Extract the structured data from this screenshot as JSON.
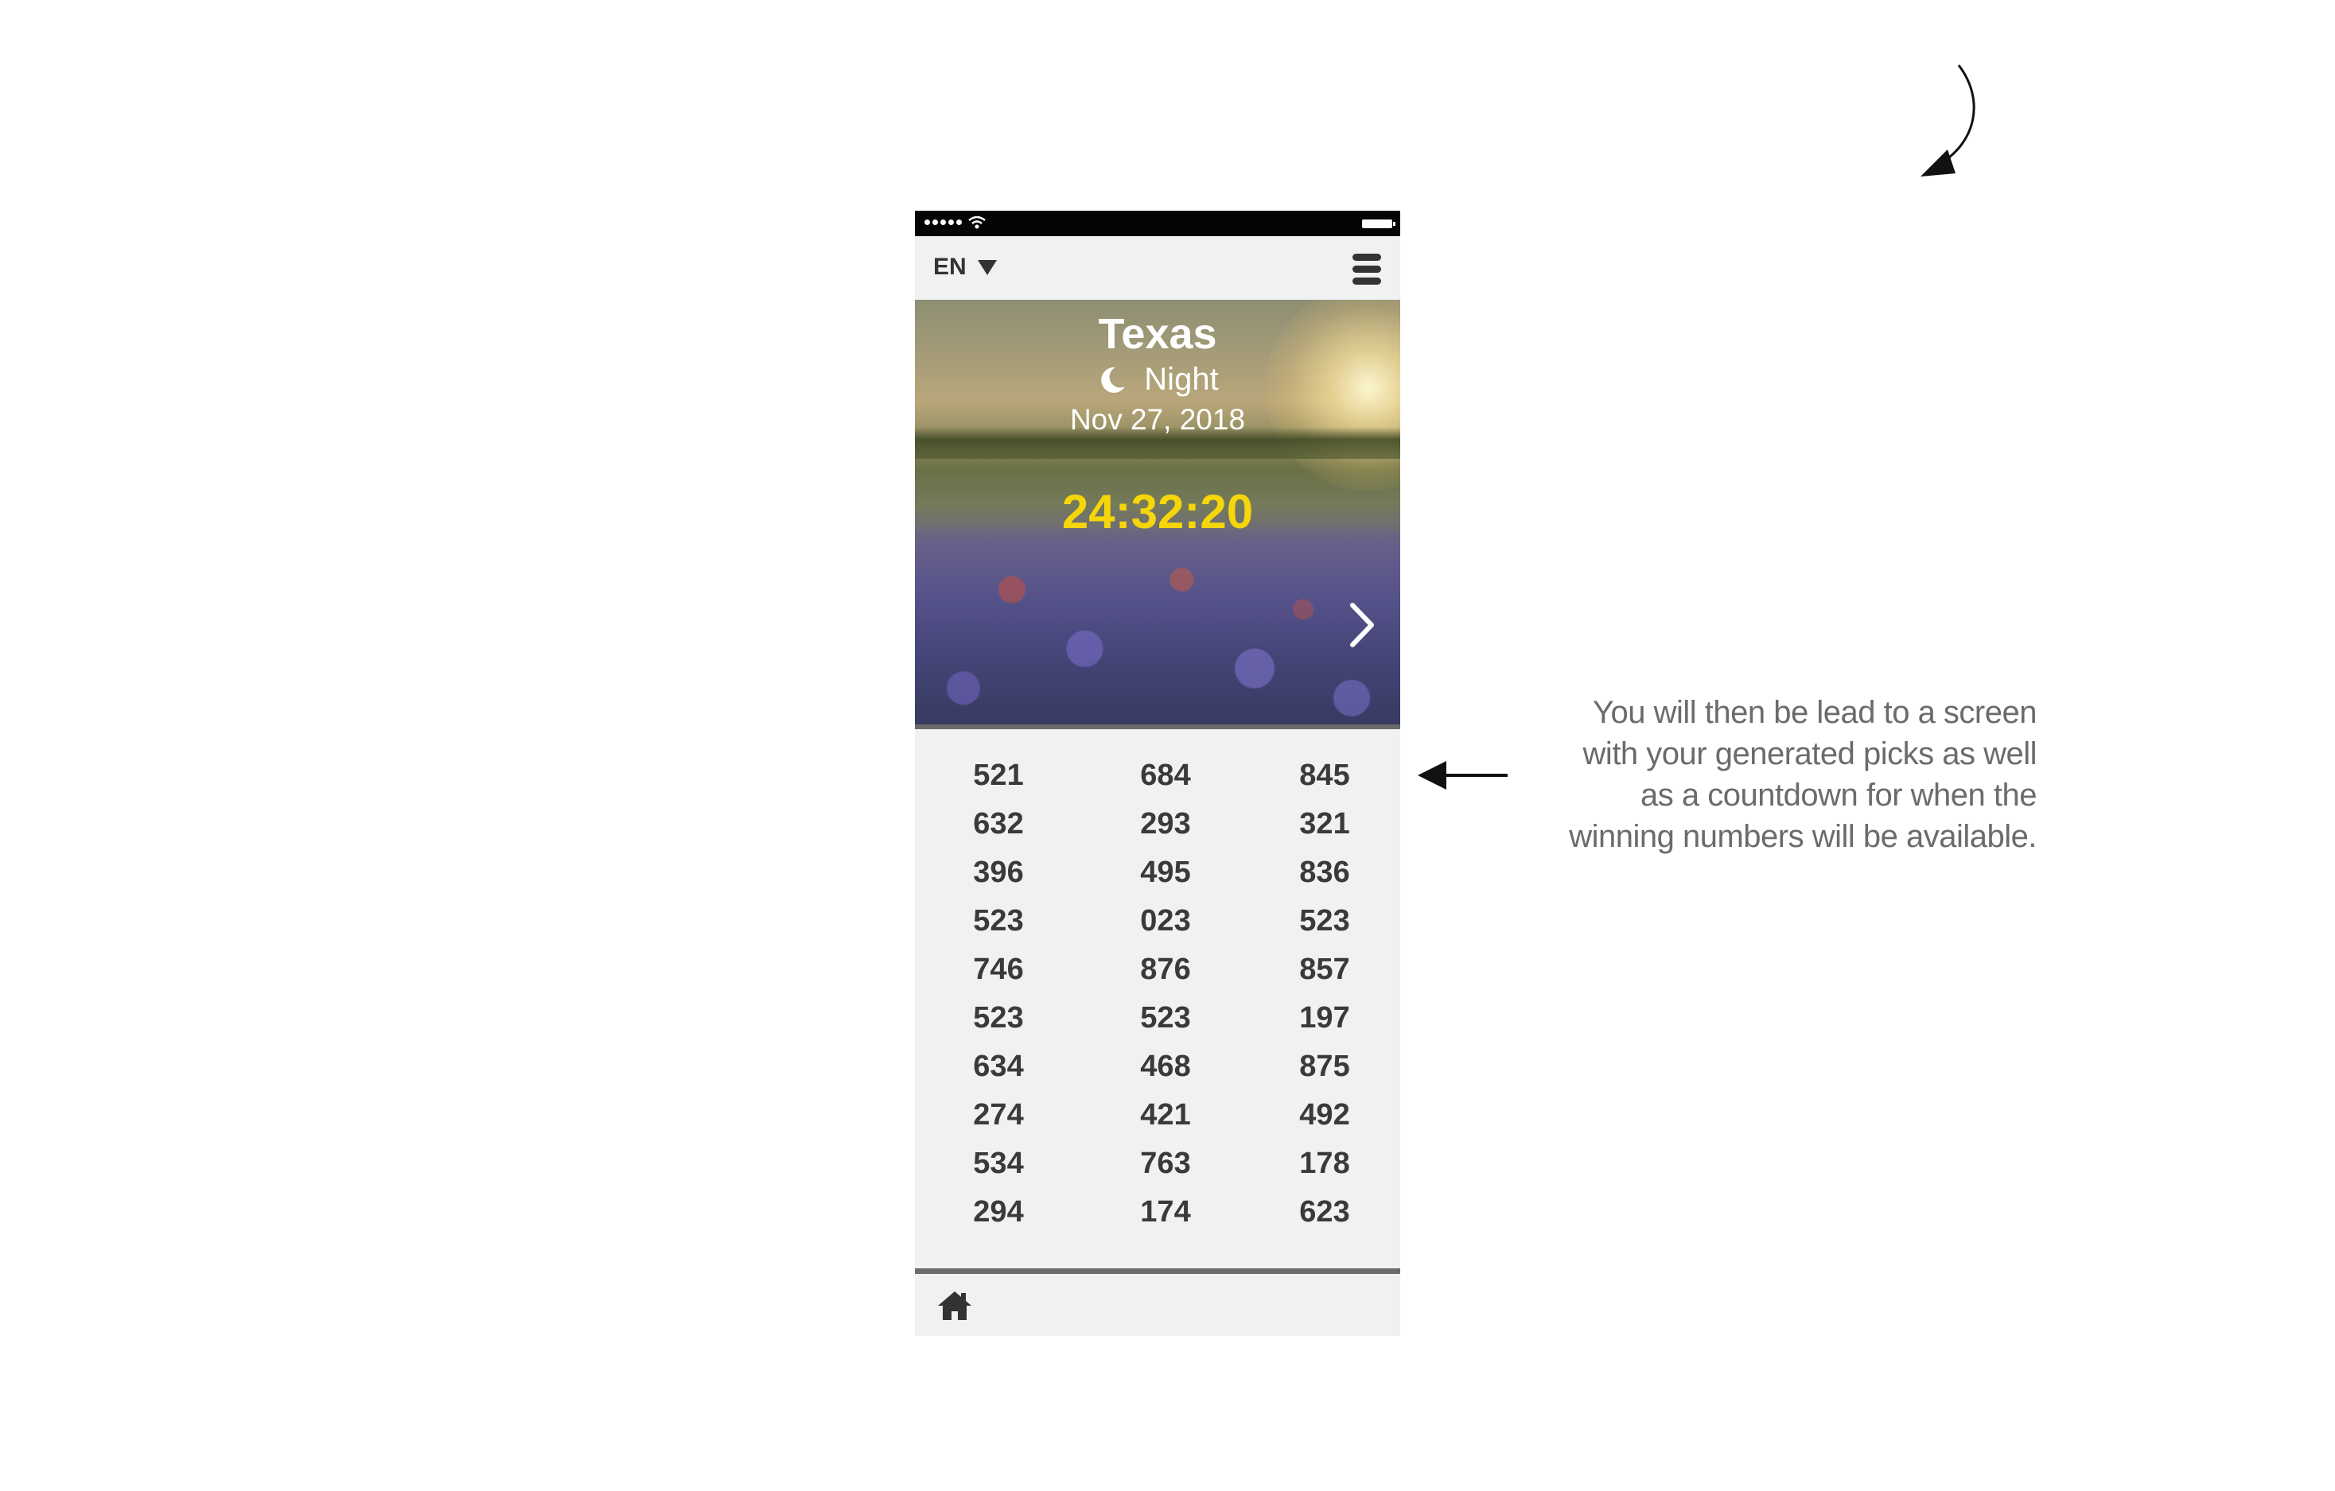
{
  "status_bar": {
    "signal_dots": 5,
    "battery_level": 1.0
  },
  "top_bar": {
    "language": "EN"
  },
  "hero": {
    "title": "Texas",
    "period": "Night",
    "date": "Nov 27, 2018",
    "countdown": "24:32:20"
  },
  "picks": [
    [
      "521",
      "684",
      "845"
    ],
    [
      "632",
      "293",
      "321"
    ],
    [
      "396",
      "495",
      "836"
    ],
    [
      "523",
      "023",
      "523"
    ],
    [
      "746",
      "876",
      "857"
    ],
    [
      "523",
      "523",
      "197"
    ],
    [
      "634",
      "468",
      "875"
    ],
    [
      "274",
      "421",
      "492"
    ],
    [
      "534",
      "763",
      "178"
    ],
    [
      "294",
      "174",
      "623"
    ]
  ],
  "annotation": {
    "lines": [
      "You will then be lead to a screen",
      "with your generated picks as well",
      "as a countdown for when the",
      "winning numbers will be available."
    ]
  },
  "colors": {
    "accent_countdown": "#f5d60a",
    "text_dark": "#3a3a3a",
    "background_panel": "#f0f1f2"
  },
  "icons": [
    "moon-icon",
    "chevron-right-icon",
    "home-icon",
    "hamburger-menu-icon",
    "wifi-icon",
    "battery-icon",
    "dropdown-caret-icon"
  ]
}
